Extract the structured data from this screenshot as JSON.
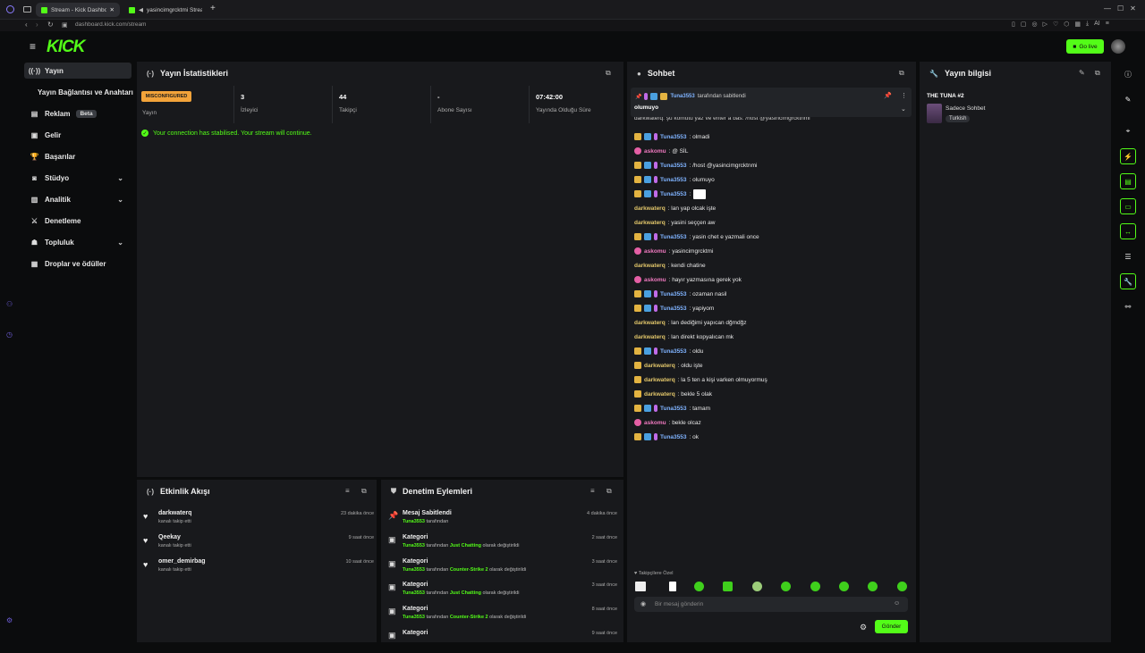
{
  "browser": {
    "tabs": [
      {
        "label": "Stream - Kick Dashboard",
        "active": true
      },
      {
        "label": "yasincimgrcktmi Stream",
        "active": false
      }
    ],
    "url": "dashboard.kick.com/stream",
    "ai_label": "AI"
  },
  "brand": {
    "logo_text": "KICK",
    "accent": "#53fc18"
  },
  "header": {
    "go_live_label": "Go live"
  },
  "sidebar": {
    "items": [
      {
        "label": "Yayın",
        "icon": "broadcast-icon"
      },
      {
        "label": "Yayın Bağlantısı ve Anahtarı",
        "icon": ""
      },
      {
        "label": "Reklam",
        "icon": "ad-icon",
        "badge": "Beta"
      },
      {
        "label": "Gelir",
        "icon": "money-icon"
      },
      {
        "label": "Başarılar",
        "icon": "trophy-icon"
      },
      {
        "label": "Stüdyo",
        "icon": "camera-icon"
      },
      {
        "label": "Analitik",
        "icon": "chart-icon"
      },
      {
        "label": "Denetleme",
        "icon": "sword-icon"
      },
      {
        "label": "Topluluk",
        "icon": "community-icon"
      },
      {
        "label": "Droplar ve ödüller",
        "icon": "gift-icon"
      }
    ]
  },
  "stats": {
    "title": "Yayın İstatistikleri",
    "status_badge": "MISCONFIGURED",
    "status_label": "Yayın",
    "cells": [
      {
        "value": "3",
        "label": "İzleyici"
      },
      {
        "value": "44",
        "label": "Takipçi"
      },
      {
        "value": "-",
        "label": "Abone Sayısı"
      },
      {
        "value": "07:42:00",
        "label": "Yayında Olduğu Süre"
      }
    ],
    "connection_msg": "Your connection has stabilised. Your stream will continue."
  },
  "chat": {
    "title": "Sohbet",
    "pinned_by": "Tuna3553",
    "pinned_suffix": "tarafından sabitlendi",
    "pinned_msg": "olumuyo",
    "cut_line": "darkwaterq: şu komutu yaz ve enter a bas: /host @yasincimgrcktnmi",
    "messages": [
      {
        "user": "Tuna3553",
        "text": ": olmadi",
        "badges": "crown-mod-mic",
        "color": "#7fb3ff"
      },
      {
        "user": "askomu",
        "text": ": @ SİL",
        "badges": "pink",
        "color": "#f07ac0"
      },
      {
        "user": "Tuna3553",
        "text": ": /host @yasincimgrcktnmi",
        "badges": "crown-mod-mic",
        "color": "#7fb3ff"
      },
      {
        "user": "Tuna3553",
        "text": ": olumuyo",
        "badges": "crown-mod-mic",
        "color": "#7fb3ff"
      },
      {
        "user": "Tuna3553",
        "text": ":",
        "badges": "crown-mod-mic",
        "color": "#7fb3ff",
        "box": true
      },
      {
        "user": "darkwaterq",
        "text": ": lan yap olcak işte",
        "badges": "",
        "color": "#e3c76b"
      },
      {
        "user": "darkwaterq",
        "text": ": yasini seççen aw",
        "badges": "",
        "color": "#e3c76b"
      },
      {
        "user": "Tuna3553",
        "text": ": yasin chet e yazmali once",
        "badges": "crown-mod-mic",
        "color": "#7fb3ff"
      },
      {
        "user": "askomu",
        "text": ": yasincimgrcktmi",
        "badges": "pink",
        "color": "#f07ac0"
      },
      {
        "user": "darkwaterq",
        "text": ": kendi chatine",
        "badges": "",
        "color": "#e3c76b"
      },
      {
        "user": "askomu",
        "text": ": hayır yazmasına gerek yok",
        "badges": "pink",
        "color": "#f07ac0"
      },
      {
        "user": "Tuna3553",
        "text": ": ozaman nasil",
        "badges": "crown-mod-mic",
        "color": "#7fb3ff"
      },
      {
        "user": "Tuna3553",
        "text": ": yapiyom",
        "badges": "crown-mod-mic",
        "color": "#7fb3ff"
      },
      {
        "user": "darkwaterq",
        "text": ": lan dediğimi yapıcan dğmdğz",
        "badges": "",
        "color": "#e3c76b"
      },
      {
        "user": "darkwaterq",
        "text": ": lan direkt kopyalıcan mk",
        "badges": "",
        "color": "#e3c76b"
      },
      {
        "user": "Tuna3553",
        "text": ": oldu",
        "badges": "crown-mod-mic",
        "color": "#7fb3ff"
      },
      {
        "user": "darkwaterq",
        "text": ": oldu işte",
        "badges": "crown",
        "color": "#e3c76b"
      },
      {
        "user": "darkwaterq",
        "text": ": la 5 ten a kişi varken olmuyormuş",
        "badges": "crown",
        "color": "#e3c76b"
      },
      {
        "user": "darkwaterq",
        "text": ": bekle 5 olak",
        "badges": "crown",
        "color": "#e3c76b"
      },
      {
        "user": "Tuna3553",
        "text": ": tamam",
        "badges": "crown-mod-mic",
        "color": "#7fb3ff"
      },
      {
        "user": "askomu",
        "text": ": bekle olcaz",
        "badges": "pink",
        "color": "#f07ac0"
      },
      {
        "user": "Tuna3553",
        "text": ": ok",
        "badges": "crown-mod-mic",
        "color": "#7fb3ff"
      }
    ],
    "followers_only": "Takipçilere Özel",
    "input_placeholder": "Bir mesaj gönderin",
    "send_label": "Gönder"
  },
  "info": {
    "title": "Yayın bilgisi",
    "stream_title": "THE TUNA #2",
    "category": "Sadece Sohbet",
    "tag": "Turkish"
  },
  "activity": {
    "title": "Etkinlik Akışı",
    "items": [
      {
        "user": "darkwaterq",
        "sub": "kanalı takip etti",
        "time": "23 dakika önce"
      },
      {
        "user": "Qeekay",
        "sub": "kanalı takip etti",
        "time": "9 saat önce"
      },
      {
        "user": "omer_demirbag",
        "sub": "kanalı takip etti",
        "time": "10 saat önce"
      }
    ]
  },
  "moderation": {
    "title": "Denetim Eylemleri",
    "items": [
      {
        "title": "Mesaj Sabitlendi",
        "who": "Tuna3553",
        "mid": "tarafından",
        "what": "",
        "end": "",
        "time": "4 dakika önce",
        "icon": "pin-icon"
      },
      {
        "title": "Kategori",
        "who": "Tuna3553",
        "mid": "tarafından",
        "what": "Just Chatting",
        "end": "olarak değiştirildi",
        "time": "2 saat önce",
        "icon": "category-icon"
      },
      {
        "title": "Kategori",
        "who": "Tuna3553",
        "mid": "tarafından",
        "what": "Counter-Strike 2",
        "end": "olarak değiştirildi",
        "time": "3 saat önce",
        "icon": "category-icon"
      },
      {
        "title": "Kategori",
        "who": "Tuna3553",
        "mid": "tarafından",
        "what": "Just Chatting",
        "end": "olarak değiştirildi",
        "time": "3 saat önce",
        "icon": "category-icon"
      },
      {
        "title": "Kategori",
        "who": "Tuna3553",
        "mid": "tarafından",
        "what": "Counter-Strike 2",
        "end": "olarak değiştirildi",
        "time": "8 saat önce",
        "icon": "category-icon"
      },
      {
        "title": "Kategori",
        "who": "",
        "mid": "",
        "what": "",
        "end": "",
        "time": "9 saat önce",
        "icon": "category-icon"
      }
    ]
  }
}
